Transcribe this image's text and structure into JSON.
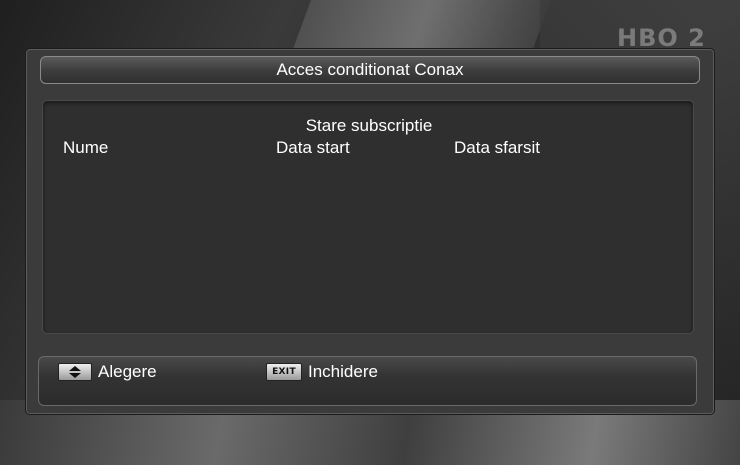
{
  "background": {
    "channel_logo": "HBO 2"
  },
  "dialog": {
    "title": "Acces conditionat Conax",
    "panel": {
      "heading": "Stare subscriptie",
      "columns": [
        "Nume",
        "Data start",
        "Data sfarsit"
      ]
    },
    "footer": {
      "select_key": "up-down-arrow-icon",
      "select_label": "Alegere",
      "exit_key_text": "EXIT",
      "exit_label": "Inchidere"
    }
  },
  "colors": {
    "text": "#ffffff",
    "dialog_bg": "#3b3b3b",
    "panel_bg": "#2f2f2f"
  }
}
